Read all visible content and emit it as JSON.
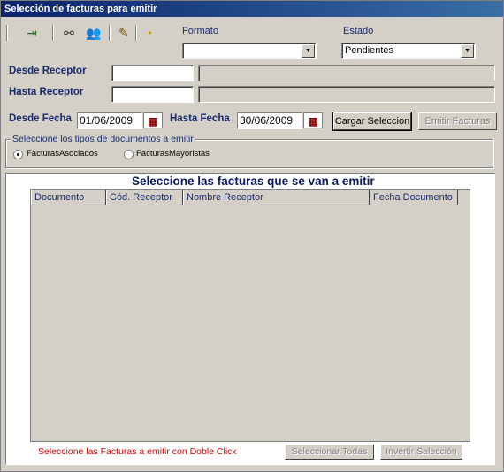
{
  "window": {
    "title": "Selección de facturas para emitir"
  },
  "toolbar": {
    "icons": [
      "exit-icon",
      "binoculars-icon",
      "users-icon",
      "edit-icon",
      "compass-icon"
    ]
  },
  "formato": {
    "label": "Formato",
    "value": ""
  },
  "estado": {
    "label": "Estado",
    "value": "Pendientes"
  },
  "desde_receptor": {
    "label": "Desde  Receptor",
    "code": "",
    "name": ""
  },
  "hasta_receptor": {
    "label": "Hasta Receptor",
    "code": "",
    "name": ""
  },
  "desde_fecha": {
    "label": "Desde Fecha",
    "value": "01/06/2009"
  },
  "hasta_fecha": {
    "label": "Hasta Fecha",
    "value": "30/06/2009"
  },
  "buttons": {
    "cargar": "Cargar Seleccion",
    "emitir": "Emitir Facturas",
    "seleccionar_todas": "Seleccionar Todas",
    "invertir": "Invertir Selección"
  },
  "tipos": {
    "legend": "Seleccione los tipos de documentos a emitir",
    "options": [
      "FacturasAsociados",
      "FacturasMayoristas"
    ],
    "selected": "FacturasAsociados"
  },
  "list": {
    "title": "Seleccione las facturas que se van a emitir",
    "columns": [
      "Documento",
      "Cód. Receptor",
      "Nombre Receptor",
      "Fecha Documento"
    ],
    "rows": []
  },
  "hint": {
    "text": "Seleccione las Facturas a emitir con Doble Click",
    "color": "#cc0000"
  }
}
